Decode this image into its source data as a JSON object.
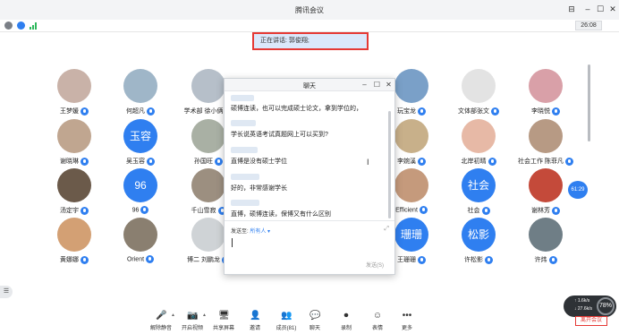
{
  "window": {
    "title": "腾讯会议",
    "controls": [
      "pin",
      "minimize",
      "maximize",
      "close"
    ]
  },
  "infobar": {
    "icons": [
      "info-icon",
      "shield-icon",
      "signal-icon"
    ],
    "clock": "26:08"
  },
  "speaking": {
    "text": "正在讲话: 郭俊翔;"
  },
  "participants": [
    {
      "name": "王梦媛",
      "kind": "photo",
      "color": "#c9b2a8"
    },
    {
      "name": "何超凡",
      "kind": "photo",
      "color": "#9fb6c8"
    },
    {
      "name": "学术部 徐小俩",
      "kind": "photo",
      "color": "#b6bfc9"
    },
    {
      "name": "",
      "kind": "hidden"
    },
    {
      "name": "",
      "kind": "hidden"
    },
    {
      "name": "",
      "kind": "hidden"
    },
    {
      "name": "玩宝龙",
      "kind": "photo",
      "color": "#7aa0c8"
    },
    {
      "name": "文体部张文",
      "kind": "photo",
      "color": "#e3e3e3"
    },
    {
      "name": "李晓悦",
      "kind": "photo",
      "color": "#d9a0a8"
    },
    {
      "name": "谢晓琳",
      "kind": "photo",
      "color": "#c0a690"
    },
    {
      "name": "吴玉容",
      "kind": "text",
      "text": "玉容",
      "color": "#2f7ff0"
    },
    {
      "name": "孙国旺",
      "kind": "photo",
      "color": "#a9b0a4"
    },
    {
      "name": "",
      "kind": "hidden"
    },
    {
      "name": "",
      "kind": "hidden"
    },
    {
      "name": "",
      "kind": "hidden"
    },
    {
      "name": "李婉溪",
      "kind": "photo",
      "color": "#c8b08a"
    },
    {
      "name": "北岸初晴",
      "kind": "photo",
      "color": "#e7b9a6"
    },
    {
      "name": "社会工作 陈菲凡",
      "kind": "photo",
      "color": "#b79a84"
    },
    {
      "name": "汤定宇",
      "kind": "photo",
      "color": "#6b5a4a"
    },
    {
      "name": "96",
      "kind": "text",
      "text": "96",
      "color": "#2f7ff0"
    },
    {
      "name": "千山雪寂",
      "kind": "photo",
      "color": "#9c8f80"
    },
    {
      "name": "",
      "kind": "hidden"
    },
    {
      "name": "",
      "kind": "hidden"
    },
    {
      "name": "",
      "kind": "hidden"
    },
    {
      "name": "Efficient",
      "kind": "photo",
      "color": "#c59a7c"
    },
    {
      "name": "社会",
      "kind": "text",
      "text": "社会",
      "color": "#2f7ff0"
    },
    {
      "name": "谢林芳",
      "kind": "photo",
      "color": "#c44a3a"
    },
    {
      "name": "黄娜娜",
      "kind": "photo",
      "color": "#d3a074"
    },
    {
      "name": "Orient",
      "kind": "photo",
      "color": "#8a7f70"
    },
    {
      "name": "博二 刘鹏龙",
      "kind": "photo",
      "color": "#cfd3d6"
    },
    {
      "name": "",
      "kind": "hidden"
    },
    {
      "name": "",
      "kind": "hidden"
    },
    {
      "name": "",
      "kind": "hidden"
    },
    {
      "name": "王珊珊",
      "kind": "text",
      "text": "珊珊",
      "color": "#2f7ff0"
    },
    {
      "name": "许松影",
      "kind": "text",
      "text": "松影",
      "color": "#2f7ff0"
    },
    {
      "name": "许炜",
      "kind": "photo",
      "color": "#6f7e86"
    }
  ],
  "chat": {
    "title": "聊天",
    "messages": [
      "硕博连读，也可以完成硕士论文，拿到学位的，",
      "学长说英语考试真题网上可以买到?",
      "直博是没有硕士学位",
      "好的，非常感谢学长",
      "直博，硕博连读，保博又有什么区别"
    ],
    "send_to_label": "发送至:",
    "send_to_value": "所有人",
    "send_button": "发送(S)"
  },
  "timer": "61:29",
  "network": {
    "line1": "↑ 1.6k/s",
    "line2": "↓ 27.6k/s",
    "percent": "78%"
  },
  "leave_button": "离开会议",
  "toolbar": [
    {
      "label": "解除静音",
      "icon": "mic-muted-icon",
      "glyph": "🎤",
      "dropdown": true
    },
    {
      "label": "开启视频",
      "icon": "camera-off-icon",
      "glyph": "📷",
      "dropdown": true
    },
    {
      "label": "共享屏幕",
      "icon": "share-screen-icon",
      "glyph": "🖥"
    },
    {
      "label": "邀请",
      "icon": "invite-icon",
      "glyph": "👤"
    },
    {
      "label": "成员(81)",
      "icon": "members-icon",
      "glyph": "👥"
    },
    {
      "label": "聊天",
      "icon": "chat-icon",
      "glyph": "💬"
    },
    {
      "label": "录制",
      "icon": "record-icon",
      "glyph": "⏺"
    },
    {
      "label": "表情",
      "icon": "emoji-icon",
      "glyph": "☺"
    },
    {
      "label": "更多",
      "icon": "more-icon",
      "glyph": "•••"
    }
  ]
}
